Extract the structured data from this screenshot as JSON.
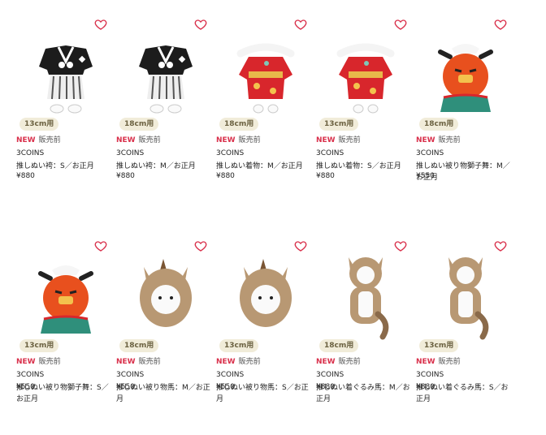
{
  "products": [
    {
      "badge": "13cm用",
      "tag": "NEW",
      "status": "販売前",
      "brand": "3COINS",
      "name": "推しぬい袴：S／お正月",
      "price": "¥880",
      "image_icon": "hakama-outfit-icon",
      "accent": "#1c1c1c"
    },
    {
      "badge": "18cm用",
      "tag": "NEW",
      "status": "販売前",
      "brand": "3COINS",
      "name": "推しぬい袴：M／お正月",
      "price": "¥880",
      "image_icon": "hakama-outfit-icon",
      "accent": "#1c1c1c"
    },
    {
      "badge": "18cm用",
      "tag": "NEW",
      "status": "販売前",
      "brand": "3COINS",
      "name": "推しぬい着物：M／お正月",
      "price": "¥880",
      "image_icon": "kimono-outfit-icon",
      "accent": "#d8262c"
    },
    {
      "badge": "13cm用",
      "tag": "NEW",
      "status": "販売前",
      "brand": "3COINS",
      "name": "推しぬい着物：S／お正月",
      "price": "¥880",
      "image_icon": "kimono-outfit-icon",
      "accent": "#d8262c"
    },
    {
      "badge": "18cm用",
      "tag": "NEW",
      "status": "販売前",
      "brand": "3COINS",
      "name": "推しぬい被り物獅子舞：M／お正月",
      "price": "¥550",
      "image_icon": "shishimai-hood-icon",
      "accent": "#e8501e"
    },
    {
      "badge": "13cm用",
      "tag": "NEW",
      "status": "販売前",
      "brand": "3COINS",
      "name": "推しぬい被り物獅子舞：S／お正月",
      "price": "¥550",
      "image_icon": "shishimai-hood-icon",
      "accent": "#e8501e"
    },
    {
      "badge": "18cm用",
      "tag": "NEW",
      "status": "販売前",
      "brand": "3COINS",
      "name": "推しぬい被り物馬：M／お正月",
      "price": "¥550",
      "image_icon": "horse-hood-icon",
      "accent": "#b89873"
    },
    {
      "badge": "13cm用",
      "tag": "NEW",
      "status": "販売前",
      "brand": "3COINS",
      "name": "推しぬい被り物馬：S／お正月",
      "price": "¥550",
      "image_icon": "horse-hood-icon",
      "accent": "#b89873"
    },
    {
      "badge": "18cm用",
      "tag": "NEW",
      "status": "販売前",
      "brand": "3COINS",
      "name": "推しぬい着ぐるみ馬：M／お正月",
      "price": "¥880",
      "image_icon": "horse-costume-icon",
      "accent": "#8a6a4a"
    },
    {
      "badge": "13cm用",
      "tag": "NEW",
      "status": "販売前",
      "brand": "3COINS",
      "name": "推しぬい着ぐるみ馬：S／お正月",
      "price": "¥880",
      "image_icon": "horse-costume-icon",
      "accent": "#8a6a4a"
    }
  ],
  "colors": {
    "new_tag": "#d9304b",
    "heart": "#d9304b",
    "badge_bg": "#f1ecd9"
  }
}
